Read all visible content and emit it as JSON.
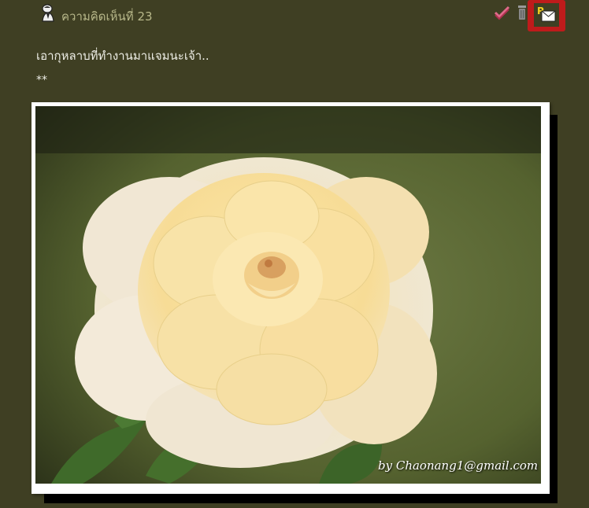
{
  "comment": {
    "title": "ความคิดเห็นที่ 23",
    "message": "เอากุหลาบที่ทำงานมาแจมนะเจ้า..",
    "stars": "**"
  },
  "actions": {
    "approve": "approve-icon",
    "delete": "trash-icon",
    "private_message": "private-message-icon"
  },
  "photo": {
    "subject": "rose",
    "watermark": "by Chaonang1@gmail.com"
  },
  "colors": {
    "background": "#3f3f23",
    "title": "#b8b88a",
    "highlight": "#bf1b1b"
  }
}
